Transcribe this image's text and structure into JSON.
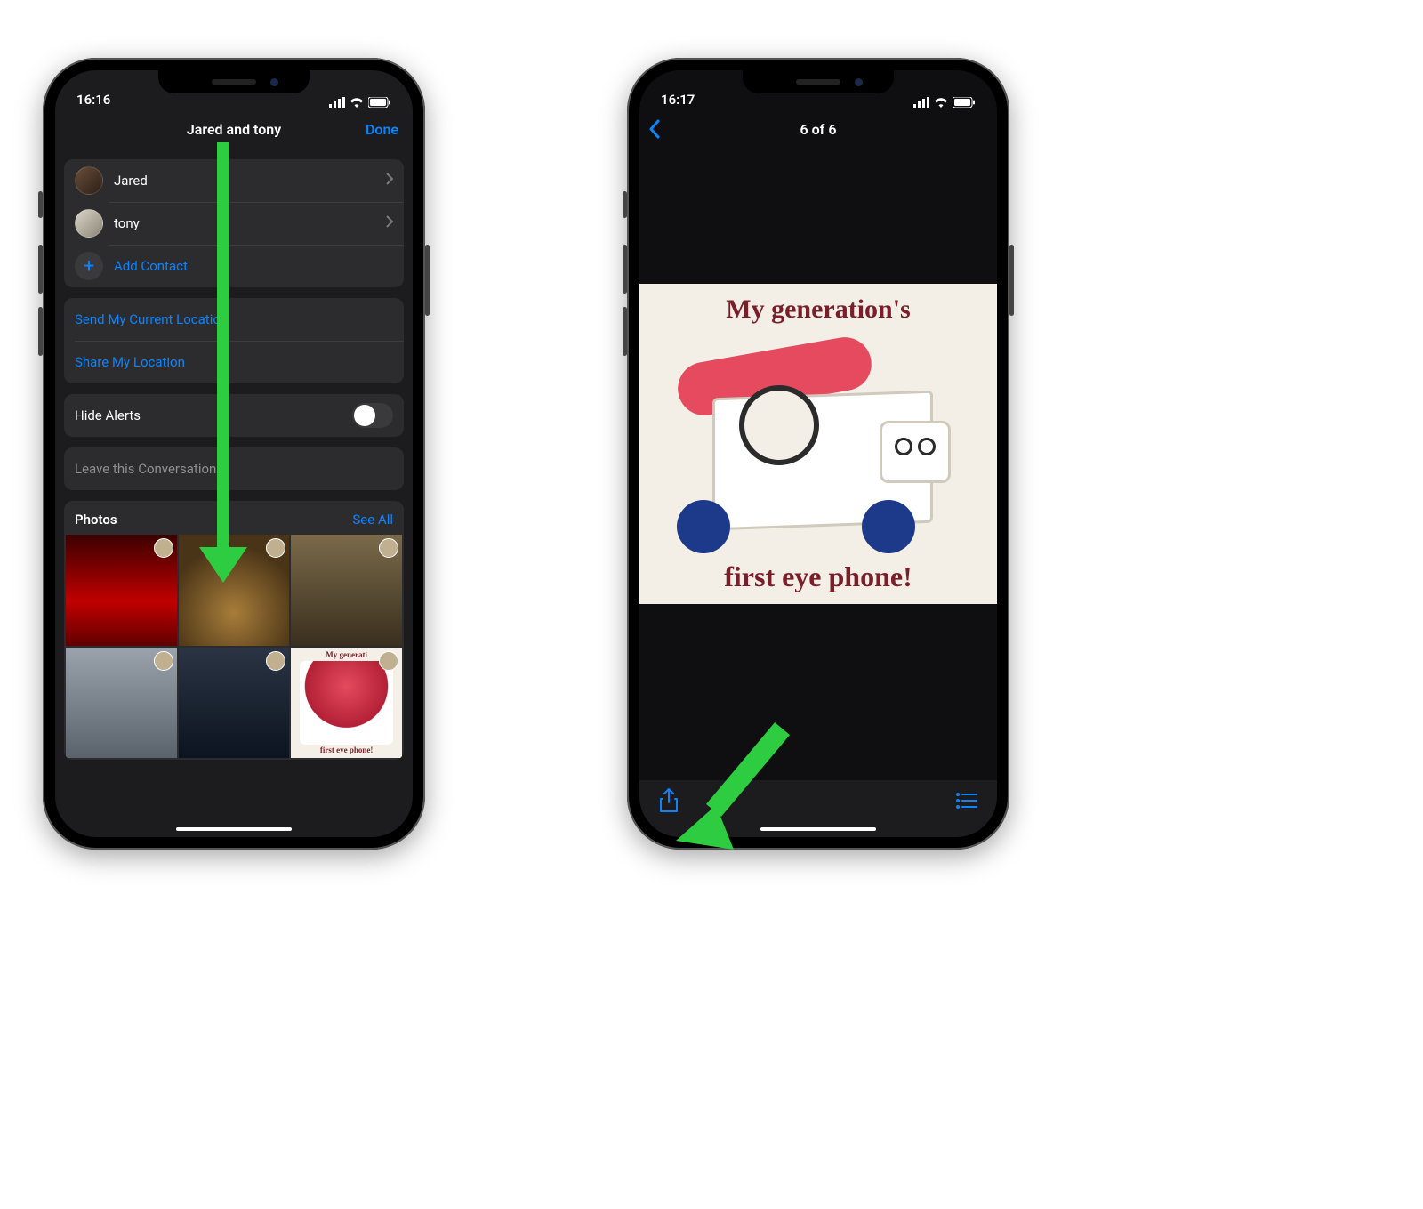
{
  "colors": {
    "accent": "#0a84ff",
    "arrow": "#2ecc40"
  },
  "left": {
    "status": {
      "time": "16:16"
    },
    "nav": {
      "title": "Jared and tony",
      "done": "Done"
    },
    "contacts": [
      {
        "name": "Jared"
      },
      {
        "name": "tony"
      }
    ],
    "add_contact": "Add Contact",
    "send_location": "Send My Current Location",
    "share_location": "Share My Location",
    "hide_alerts": "Hide Alerts",
    "hide_alerts_on": false,
    "leave_conversation": "Leave this Conversation",
    "photos_header": "Photos",
    "see_all": "See All",
    "meme_thumb": {
      "top": "My generati",
      "bot": "first eye phone!"
    }
  },
  "right": {
    "status": {
      "time": "16:17"
    },
    "nav": {
      "title": "6 of 6"
    },
    "meme": {
      "top": "My generation's",
      "bot": "first eye phone!"
    }
  }
}
